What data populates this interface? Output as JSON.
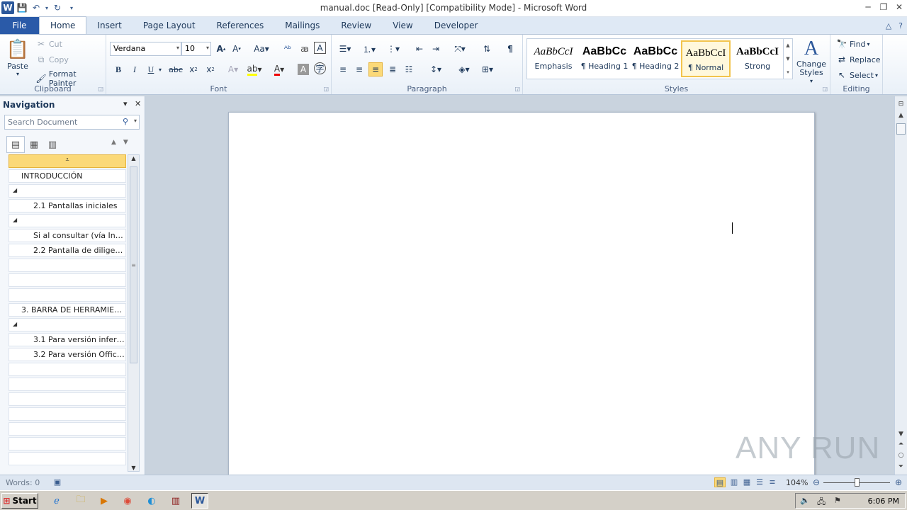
{
  "window": {
    "title": "manual.doc [Read-Only] [Compatibility Mode]  -  Microsoft Word"
  },
  "qat": {
    "logo": "W"
  },
  "tabs": [
    {
      "label": "File"
    },
    {
      "label": "Home"
    },
    {
      "label": "Insert"
    },
    {
      "label": "Page Layout"
    },
    {
      "label": "References"
    },
    {
      "label": "Mailings"
    },
    {
      "label": "Review"
    },
    {
      "label": "View"
    },
    {
      "label": "Developer"
    }
  ],
  "clipboard": {
    "paste": "Paste",
    "cut": "Cut",
    "copy": "Copy",
    "format_painter": "Format Painter",
    "label": "Clipboard"
  },
  "font": {
    "name": "Verdana",
    "size": "10",
    "label": "Font"
  },
  "paragraph": {
    "label": "Paragraph"
  },
  "styles": {
    "label": "Styles",
    "tiles": [
      {
        "sample": "AaBbCcI",
        "name": "Emphasis"
      },
      {
        "sample": "AaBbCc",
        "name": "¶ Heading 1"
      },
      {
        "sample": "AaBbCc",
        "name": "¶ Heading 2"
      },
      {
        "sample": "AaBbCcI",
        "name": "¶ Normal"
      },
      {
        "sample": "AaBbCcI",
        "name": "Strong"
      }
    ],
    "change_styles": "Change Styles"
  },
  "editing": {
    "find": "Find",
    "replace": "Replace",
    "select": "Select",
    "label": "Editing"
  },
  "navigation": {
    "title": "Navigation",
    "search_placeholder": "Search Document",
    "items": [
      {
        "text": "INTRODUCCIÓN",
        "level": 1
      },
      {
        "text": "",
        "level": 1
      },
      {
        "text": "2.1 Pantallas iniciales",
        "level": 2
      },
      {
        "text": "",
        "level": 1
      },
      {
        "text": "Si al consultar (vía Inter...",
        "level": 2
      },
      {
        "text": "2.2 Pantalla de diligenc...",
        "level": 2
      },
      {
        "text": "",
        "level": 1
      },
      {
        "text": "",
        "level": 1
      },
      {
        "text": "",
        "level": 1
      },
      {
        "text": "3. BARRA DE HERRAMIENT...",
        "level": 1
      },
      {
        "text": "",
        "level": 1
      },
      {
        "text": "3.1 Para versión inferio...",
        "level": 2
      },
      {
        "text": "3.2 Para versión Office ...",
        "level": 2
      },
      {
        "text": "",
        "level": 1
      },
      {
        "text": "",
        "level": 1
      },
      {
        "text": "",
        "level": 1
      },
      {
        "text": "",
        "level": 1
      },
      {
        "text": "",
        "level": 1
      },
      {
        "text": "",
        "level": 1
      },
      {
        "text": "",
        "level": 1
      }
    ]
  },
  "statusbar": {
    "words": "Words: 0",
    "zoom": "104%"
  },
  "watermark": "ANY RUN",
  "taskbar": {
    "start": "Start",
    "clock": "6:06 PM"
  }
}
